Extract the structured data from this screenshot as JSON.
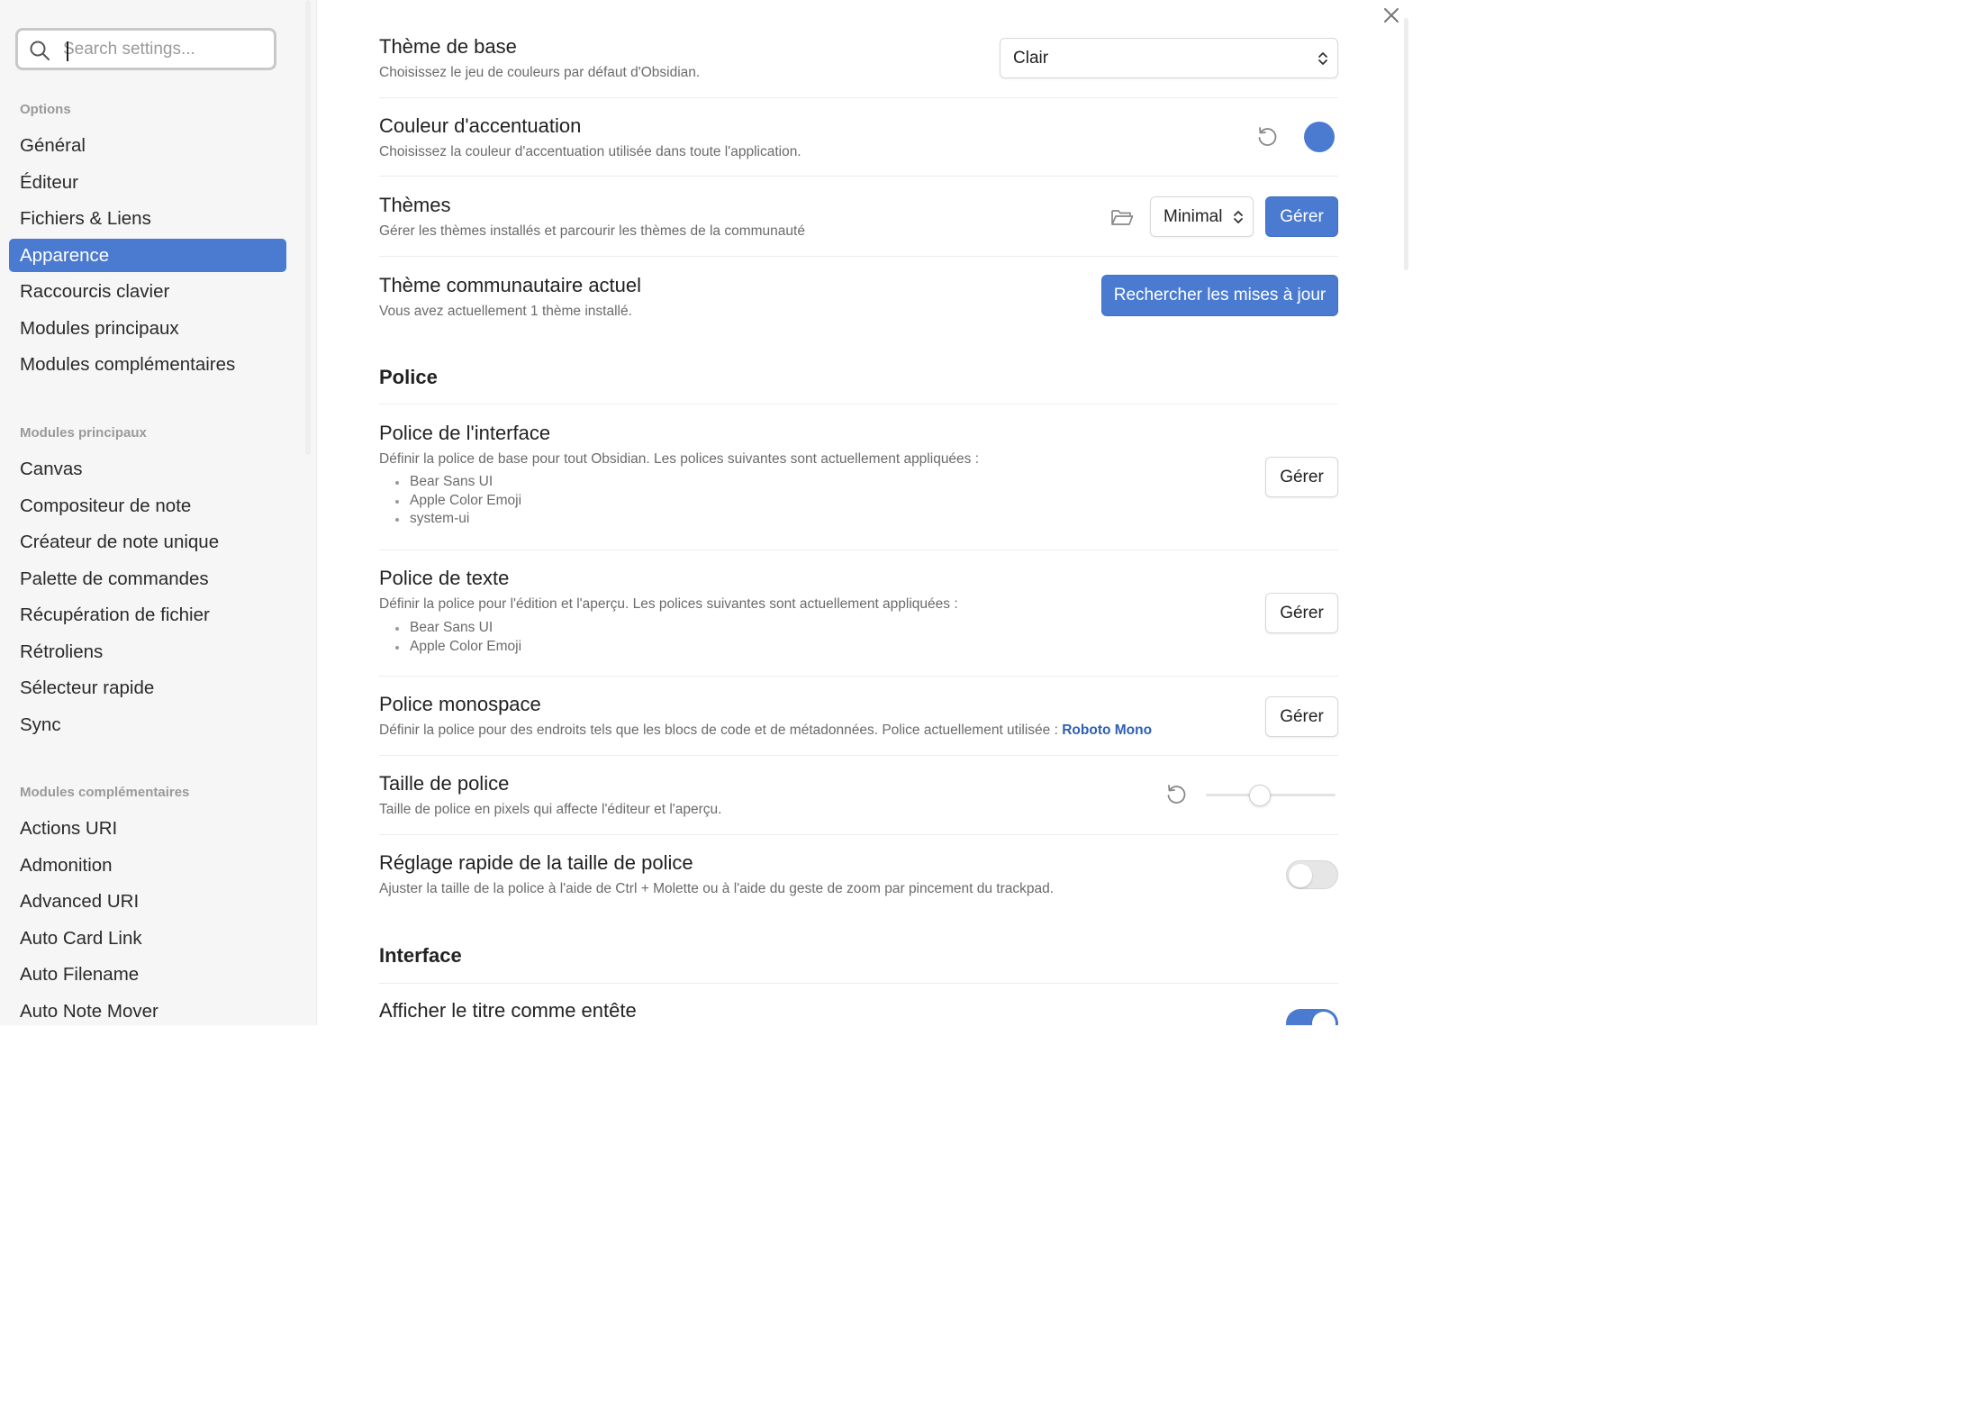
{
  "search": {
    "placeholder": "Search settings..."
  },
  "sidebar": {
    "options_header": "Options",
    "options": [
      "Général",
      "Éditeur",
      "Fichiers & Liens",
      "Apparence",
      "Raccourcis clavier",
      "Modules principaux",
      "Modules complémentaires"
    ],
    "active_item": "Apparence",
    "core_header": "Modules principaux",
    "core": [
      "Canvas",
      "Compositeur de note",
      "Créateur de note unique",
      "Palette de commandes",
      "Récupération de fichier",
      "Rétroliens",
      "Sélecteur rapide",
      "Sync"
    ],
    "community_header": "Modules complémentaires",
    "community": [
      "Actions URI",
      "Admonition",
      "Advanced URI",
      "Auto Card Link",
      "Auto Filename",
      "Auto Note Mover"
    ]
  },
  "settings": {
    "base_theme": {
      "title": "Thème de base",
      "desc": "Choisissez le jeu de couleurs par défaut d'Obsidian.",
      "value": "Clair"
    },
    "accent": {
      "title": "Couleur d'accentuation",
      "desc": "Choisissez la couleur d'accentuation utilisée dans toute l'application.",
      "color": "#4a7bd0"
    },
    "themes": {
      "title": "Thèmes",
      "desc": "Gérer les thèmes installés et parcourir les thèmes de la communauté",
      "value": "Minimal",
      "manage": "Gérer"
    },
    "community_theme": {
      "title": "Thème communautaire actuel",
      "desc": "Vous avez actuellement 1 thème installé.",
      "button": "Rechercher les mises à jour"
    },
    "font_section": "Police",
    "interface_font": {
      "title": "Police de l'interface",
      "desc": "Définir la police de base pour tout Obsidian. Les polices suivantes sont actuellement appliquées :",
      "fonts": [
        "Bear Sans UI",
        "Apple Color Emoji",
        "system-ui"
      ],
      "button": "Gérer"
    },
    "text_font": {
      "title": "Police de texte",
      "desc": "Définir la police pour l'édition et l'aperçu. Les polices suivantes sont actuellement appliquées :",
      "fonts": [
        "Bear Sans UI",
        "Apple Color Emoji"
      ],
      "button": "Gérer"
    },
    "mono_font": {
      "title": "Police monospace",
      "desc": "Définir la police pour des endroits tels que les blocs de code et de métadonnées. Police actuellement utilisée :",
      "current": "Roboto Mono",
      "button": "Gérer"
    },
    "font_size": {
      "title": "Taille de police",
      "desc": "Taille de police en pixels qui affecte l'éditeur et l'aperçu.",
      "level": 0.42
    },
    "quick_font": {
      "title": "Réglage rapide de la taille de police",
      "desc": "Ajuster la taille de la police à l'aide de Ctrl + Molette ou à l'aide du geste de zoom par pincement du trackpad.",
      "enabled": false
    },
    "interface_section": "Interface",
    "title_header": {
      "title": "Afficher le titre comme entête",
      "enabled": true
    }
  },
  "icons": {
    "search": "search-icon",
    "close": "close-icon",
    "reset": "reset-icon",
    "folder": "folder-icon",
    "chevron": "chevron-updown-icon"
  }
}
